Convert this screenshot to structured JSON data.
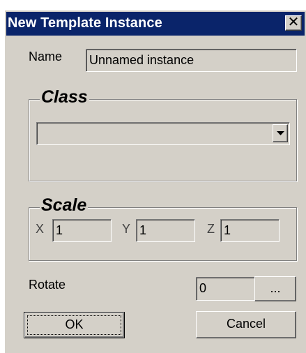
{
  "window": {
    "title": "New Template Instance",
    "close_glyph": "✕"
  },
  "name_field": {
    "label": "Name",
    "value": "Unnamed instance"
  },
  "class_group": {
    "title": "Class",
    "select_value": "",
    "dropdown_icon": "chevron-down-icon"
  },
  "scale_group": {
    "title": "Scale",
    "x_label": "X",
    "x_value": "1",
    "y_label": "Y",
    "y_value": "1",
    "z_label": "Z",
    "z_value": "1"
  },
  "rotate": {
    "label": "Rotate",
    "value": "0",
    "browse_label": "..."
  },
  "buttons": {
    "ok_label": "OK",
    "cancel_label": "Cancel"
  },
  "colors": {
    "titlebar": "#0a246a",
    "face": "#d4d0c8"
  }
}
